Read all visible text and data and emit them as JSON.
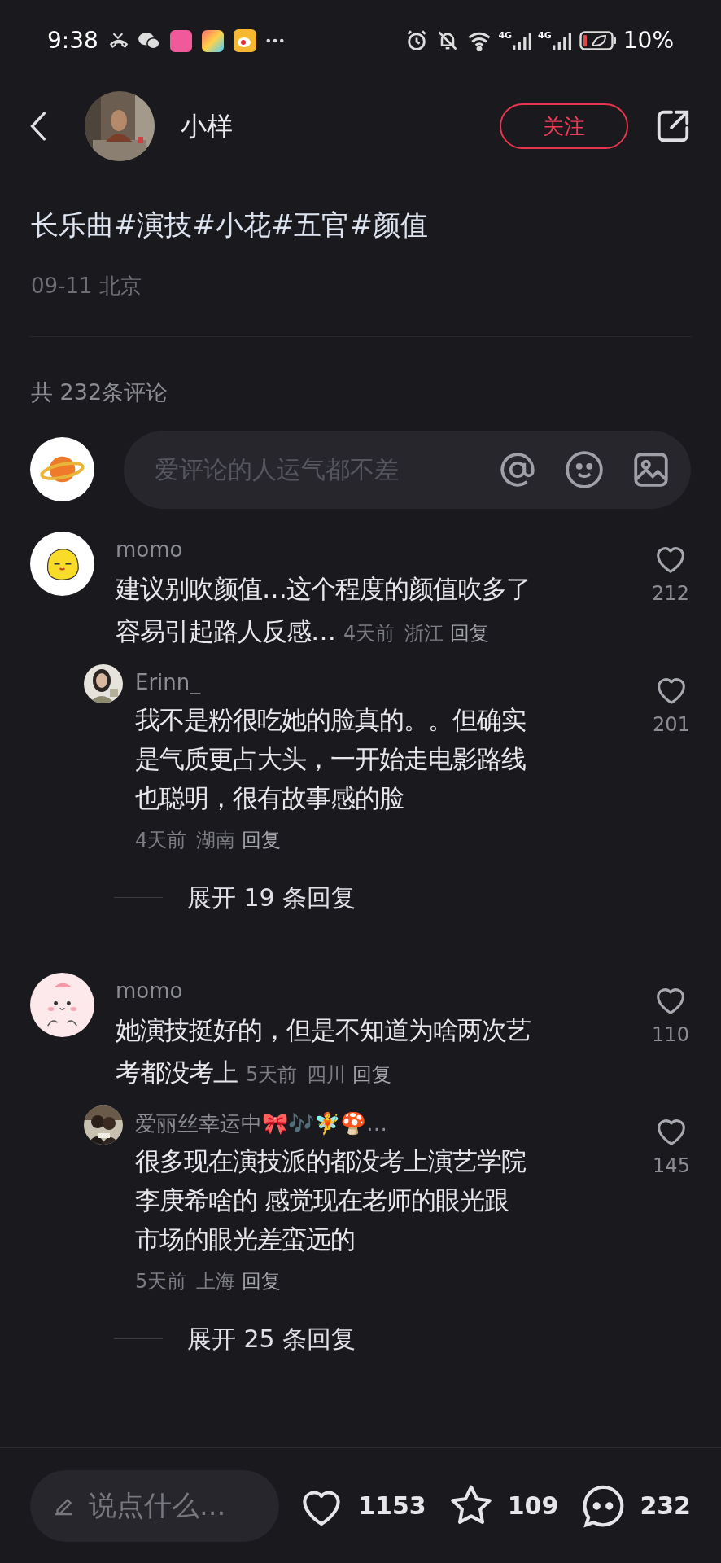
{
  "status_bar": {
    "time": "9:38",
    "network": [
      "4G",
      "4G"
    ],
    "battery": "10%"
  },
  "header": {
    "username": "小样",
    "follow_button": "关注"
  },
  "post": {
    "tags": "长乐曲#演技#小花#五官#颜值",
    "date": "09-11 北京"
  },
  "comments_section": {
    "count": "共 232条评论",
    "input": {
      "placeholder": "爱评论的人运气都不差"
    },
    "comments": [
      {
        "user": "momo",
        "kind": "chick",
        "lines": [
          "建议别吹颜值…这个程度的颜值吹多了",
          "容易引起路人反感…"
        ],
        "time": "4天前",
        "region": "浙江",
        "reply": "回复",
        "likes": "212",
        "replies": [
          {
            "user": "Erinn_",
            "lines": [
              "我不是粉很吃她的脸真的。。但确实",
              "是气质更占大头，一开始走电影路线",
              "也聪明，很有故事感的脸"
            ],
            "time": "4天前",
            "region": "湖南",
            "reply": "回复",
            "likes": "201"
          }
        ],
        "expand": "展开 19 条回复"
      },
      {
        "user": "momo",
        "kind": "bunny",
        "lines": [
          "她演技挺好的，但是不知道为啥两次艺",
          "考都没考上"
        ],
        "time": "5天前",
        "region": "四川",
        "reply": "回复",
        "likes": "110",
        "replies": [
          {
            "user": "爱丽丝幸运中🎀🎶🧚🍄…",
            "lines": [
              "很多现在演技派的都没考上演艺学院",
              "李庚希啥的 感觉现在老师的眼光跟",
              "市场的眼光差蛮远的"
            ],
            "time": "5天前",
            "region": "上海",
            "reply": "回复",
            "likes": "145"
          }
        ],
        "expand": "展开 25 条回复"
      }
    ]
  },
  "bottom_bar": {
    "placeholder": "说点什么...",
    "likes": "1153",
    "favorites": "109",
    "comments": "232"
  }
}
